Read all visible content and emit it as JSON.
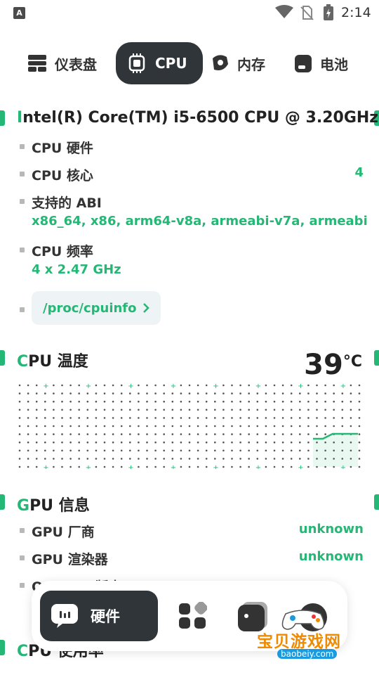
{
  "status_bar": {
    "app_letter": "A",
    "time": "2:14"
  },
  "tabs": [
    {
      "label": "仪表盘",
      "icon": "dashboard-icon",
      "active": false
    },
    {
      "label": "CPU",
      "icon": "cpu-chip-icon",
      "active": true
    },
    {
      "label": "内存",
      "icon": "memory-icon",
      "active": false
    },
    {
      "label": "电池",
      "icon": "battery-icon",
      "active": false
    }
  ],
  "cpu_info": {
    "title_first": "I",
    "title_rest": "ntel(R) Core(TM) i5-6500 CPU @ 3.20GHz",
    "items": [
      {
        "key": "CPU 硬件",
        "value": ""
      },
      {
        "key": "CPU 核心",
        "value": "4"
      },
      {
        "key": "支持的 ABI",
        "value": "x86_64, x86, arm64-v8a, armeabi-v7a, armeabi"
      },
      {
        "key": "CPU 频率",
        "value": "4 x 2.47 GHz"
      }
    ],
    "link": "/proc/cpuinfo"
  },
  "cpu_temp": {
    "title_first": "C",
    "title_rest": "PU 温度",
    "value": "39",
    "unit": "°C"
  },
  "gpu_info": {
    "title_first": "G",
    "title_rest": "PU 信息",
    "items": [
      {
        "key": "GPU 厂商",
        "value": "unknown"
      },
      {
        "key": "GPU 渲染器",
        "value": "unknown"
      }
    ],
    "cut_item": "OpenGL 版本"
  },
  "cpu_usage": {
    "title_first": "C",
    "title_rest": "PU 使用率"
  },
  "bottom_nav": {
    "active_label": "硬件"
  },
  "watermark": {
    "text": "宝贝游戏网",
    "url": "baobeiy.com"
  },
  "colors": {
    "accent": "#25b775",
    "dark": "#2f3539"
  }
}
